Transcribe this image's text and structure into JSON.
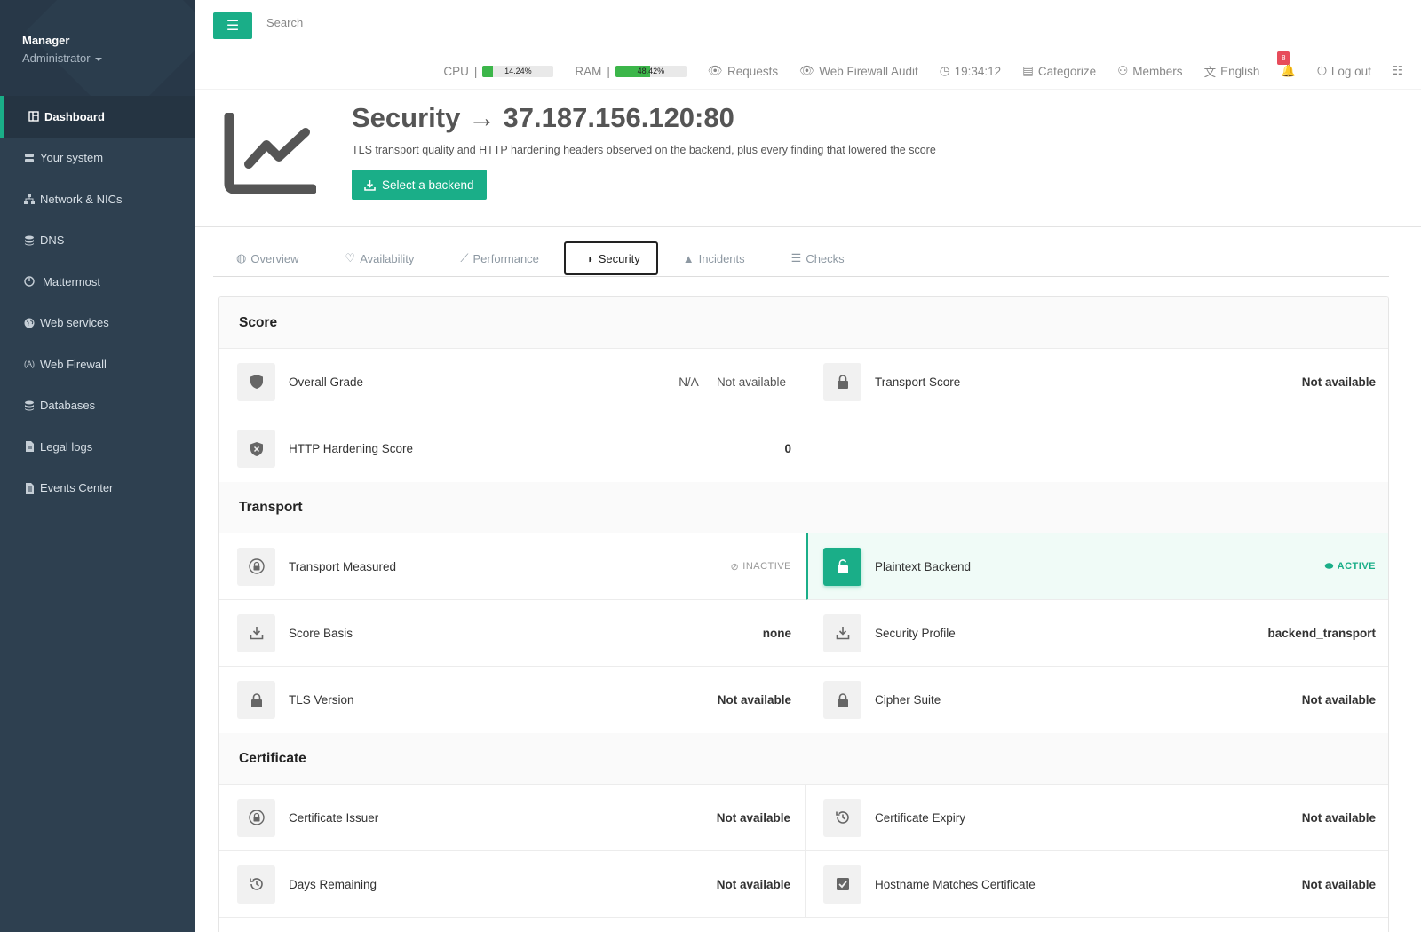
{
  "sidebar": {
    "user_name": "Manager",
    "user_role": "Administrator",
    "items": [
      {
        "label": "Dashboard",
        "icon": "dashboard-icon"
      },
      {
        "label": "Your system",
        "icon": "server-icon"
      },
      {
        "label": "Network & NICs",
        "icon": "network-icon"
      },
      {
        "label": "DNS",
        "icon": "database-icon"
      },
      {
        "label": "Mattermost",
        "icon": "power-icon"
      },
      {
        "label": "Web services",
        "icon": "globe-icon"
      },
      {
        "label": "Web Firewall",
        "icon": "firewall-icon"
      },
      {
        "label": "Databases",
        "icon": "database-icon"
      },
      {
        "label": "Legal logs",
        "icon": "file-icon"
      },
      {
        "label": "Events Center",
        "icon": "events-icon"
      }
    ]
  },
  "topbar": {
    "search_placeholder": "Search",
    "cpu_label": "CPU",
    "cpu_value": "14.24%",
    "cpu_fraction": 0.1424,
    "ram_label": "RAM",
    "ram_value": "48.42%",
    "ram_fraction": 0.4842,
    "requests": "Requests",
    "waf_audit": "Web Firewall Audit",
    "clock": "19:34:12",
    "categorize": "Categorize",
    "members": "Members",
    "language": "English",
    "notifications_count": "8",
    "logout": "Log out"
  },
  "hero": {
    "title": "Security → 37.187.156.120:80",
    "subtitle": "TLS transport quality and HTTP hardening headers observed on the backend, plus every finding that lowered the score",
    "button": "Select a backend"
  },
  "tabs": [
    {
      "label": "Overview"
    },
    {
      "label": "Availability"
    },
    {
      "label": "Performance"
    },
    {
      "label": "Security"
    },
    {
      "label": "Incidents"
    },
    {
      "label": "Checks"
    }
  ],
  "sections": {
    "score": {
      "title": "Score",
      "overall_grade_label": "Overall Grade",
      "overall_grade_value": "N/A — Not available",
      "transport_score_label": "Transport Score",
      "transport_score_value": "Not available",
      "http_hardening_label": "HTTP Hardening Score",
      "http_hardening_value": "0"
    },
    "transport": {
      "title": "Transport",
      "measured_label": "Transport Measured",
      "measured_status": "INACTIVE",
      "plaintext_label": "Plaintext Backend",
      "plaintext_status": "ACTIVE",
      "score_basis_label": "Score Basis",
      "score_basis_value": "none",
      "security_profile_label": "Security Profile",
      "security_profile_value": "backend_transport",
      "tls_version_label": "TLS Version",
      "tls_version_value": "Not available",
      "cipher_suite_label": "Cipher Suite",
      "cipher_suite_value": "Not available"
    },
    "certificate": {
      "title": "Certificate",
      "issuer_label": "Certificate Issuer",
      "issuer_value": "Not available",
      "expiry_label": "Certificate Expiry",
      "expiry_value": "Not available",
      "days_remaining_label": "Days Remaining",
      "days_remaining_value": "Not available",
      "hostname_match_label": "Hostname Matches Certificate",
      "hostname_match_value": "Not available"
    }
  },
  "colors": {
    "accent": "#1aae88",
    "sidebar": "#2e4050",
    "meter": "#3cb64a",
    "badge": "#e74c5b"
  }
}
